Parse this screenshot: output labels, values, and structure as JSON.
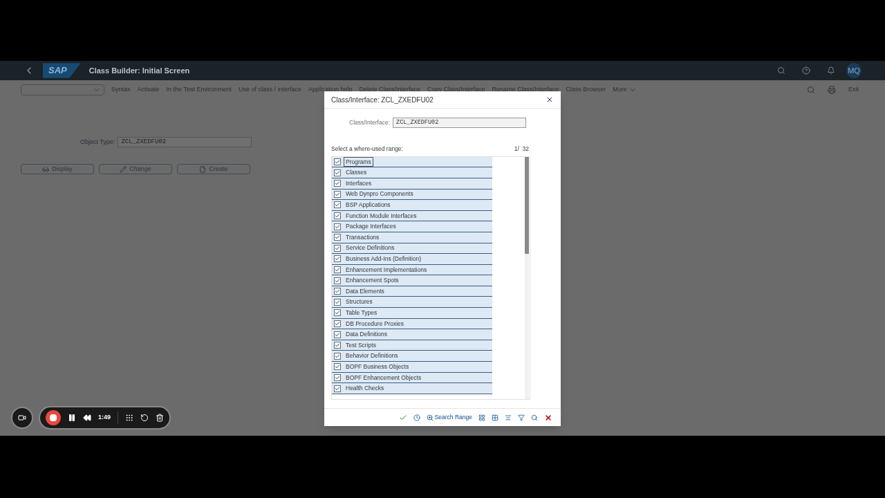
{
  "header": {
    "title": "Class Builder: Initial Screen",
    "logo": "SAP",
    "avatar": "MQ"
  },
  "toolbar": {
    "items": [
      "Syntax",
      "Activate",
      "In the Test Environment",
      "Use of class / interface",
      "Application help",
      "Delete Class/Interface",
      "Copy Class/Interface",
      "Rename Class/Interface",
      "Class Browser"
    ],
    "more": "More",
    "exit": "Exit"
  },
  "form": {
    "label": "Object Type:",
    "value": "ZCL_ZXEDFU02",
    "buttons": [
      {
        "kind": "display",
        "label": "Display"
      },
      {
        "kind": "change",
        "label": "Change"
      },
      {
        "kind": "create",
        "label": "Create"
      }
    ]
  },
  "dialog": {
    "title": "Class/Interface: ZCL_ZXEDFU02",
    "field_label": "Class/Interface:",
    "field_value": "ZCL_ZXEDFU02",
    "range_label": "Select a where-used range:",
    "counter": "1/  32",
    "items": [
      {
        "label": "Programs",
        "checked": true,
        "selected": true
      },
      {
        "label": "Classes",
        "checked": true,
        "selected": false
      },
      {
        "label": "Interfaces",
        "checked": true,
        "selected": false
      },
      {
        "label": "Web Dynpro Components",
        "checked": true,
        "selected": false
      },
      {
        "label": "BSP Applications",
        "checked": true,
        "selected": false
      },
      {
        "label": "Function Module Interfaces",
        "checked": true,
        "selected": false
      },
      {
        "label": "Package Interfaces",
        "checked": true,
        "selected": false
      },
      {
        "label": "Transactions",
        "checked": true,
        "selected": false
      },
      {
        "label": "Service Definitions",
        "checked": true,
        "selected": false
      },
      {
        "label": "Business Add-Ins (Definition)",
        "checked": true,
        "selected": false
      },
      {
        "label": "Enhancement Implementations",
        "checked": true,
        "selected": false
      },
      {
        "label": "Enhancement Spots",
        "checked": true,
        "selected": false
      },
      {
        "label": "Data Elements",
        "checked": true,
        "selected": false
      },
      {
        "label": "Structures",
        "checked": true,
        "selected": false
      },
      {
        "label": "Table Types",
        "checked": true,
        "selected": false
      },
      {
        "label": "DB Procedure Proxies",
        "checked": true,
        "selected": false
      },
      {
        "label": "Data Definitions",
        "checked": true,
        "selected": false
      },
      {
        "label": "Test Scripts",
        "checked": true,
        "selected": false
      },
      {
        "label": "Behavior Definitions",
        "checked": true,
        "selected": false
      },
      {
        "label": "BOPF Business Objects",
        "checked": true,
        "selected": false
      },
      {
        "label": "BOPF Enhancement Objects",
        "checked": true,
        "selected": false
      },
      {
        "label": "Health Checks",
        "checked": true,
        "selected": false
      }
    ],
    "search_range": "Search Range"
  },
  "recorder": {
    "time": "1:49"
  }
}
